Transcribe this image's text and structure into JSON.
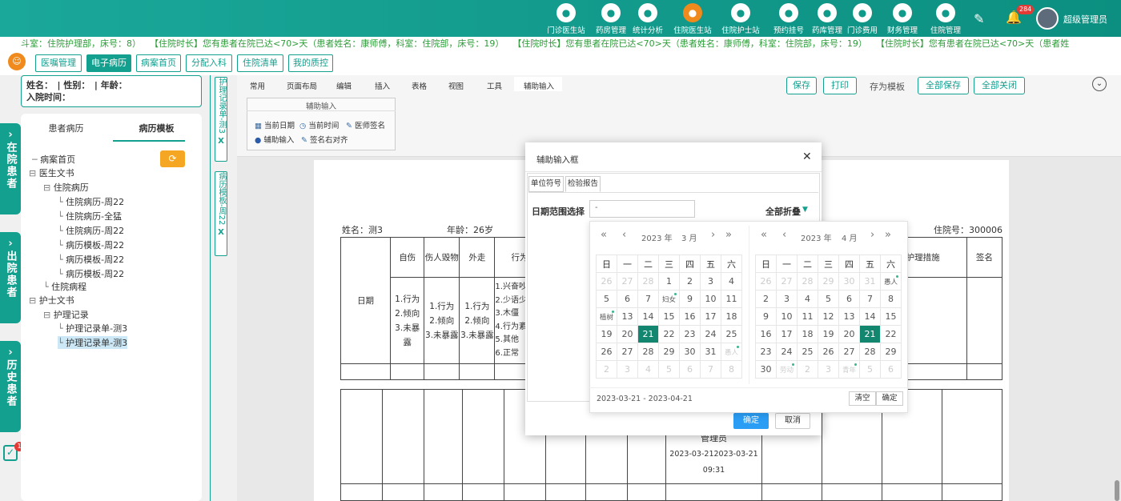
{
  "topnav": {
    "items": [
      {
        "label": "门诊医生站",
        "icon": "doctor-icon"
      },
      {
        "label": "药房管理",
        "icon": "pill-icon"
      },
      {
        "label": "统计分析",
        "icon": "chart-icon"
      },
      {
        "label": "住院医生站",
        "icon": "inpatient-doctor-icon"
      },
      {
        "label": "住院护士站",
        "icon": "nurse-icon"
      },
      {
        "label": "预约挂号",
        "icon": "calendar-icon"
      },
      {
        "label": "药库管理",
        "icon": "warehouse-icon"
      },
      {
        "label": "门诊费用",
        "icon": "yen-icon"
      },
      {
        "label": "财务管理",
        "icon": "gear-icon"
      },
      {
        "label": "住院管理",
        "icon": "bed-icon"
      }
    ],
    "bell_count": "284",
    "user_name": "超级管理员"
  },
  "marquee": "斗室：住院护理部，床号：8）　　【住院时长】您有患者在院已达<70>天（患者姓名：康师傅，科室：住院部，床号：19）　　【住院时长】您有患者在院已达<70>天（患者姓名：康师傅，科室：住院部，床号：19）　　【住院时长】您有患者在院已达<70>天（患者姓",
  "tabs": [
    "医嘱管理",
    "电子病历",
    "病案首页",
    "分配入科",
    "住院清单",
    "我的质控"
  ],
  "sidetabs": [
    "在院患者",
    "出院患者",
    "历史患者"
  ],
  "notif_count": "1",
  "patient": {
    "line1": "姓名：　| 性别：　| 年龄：",
    "line2": "入院时间："
  },
  "tree": {
    "tab1": "患者病历",
    "tab2": "病历模板",
    "nodes": [
      "病案首页",
      "医生文书",
      "住院病历",
      "住院病历-周22",
      "住院病历-全猛",
      "住院病历-周22",
      "病历模板-周22",
      "病历模板-周22",
      "病历模板-周22",
      "住院病程",
      "护士文书",
      "护理记录",
      "护理记录单-测3",
      "护理记录单-测3"
    ]
  },
  "doctabs": [
    {
      "label": "护理记录单-测3",
      "close": "X"
    },
    {
      "label": "病历模板-周22",
      "close": "X"
    }
  ],
  "ribbon": {
    "tabs": [
      "常用",
      "页面布局",
      "编辑",
      "插入",
      "表格",
      "视图",
      "工具",
      "辅助输入"
    ],
    "buttons": [
      "保存",
      "打印",
      "存为模板",
      "全部保存",
      "全部关闭"
    ],
    "group_title": "辅助输入",
    "group_items": [
      "当前日期",
      "当前时间",
      "医师签名",
      "辅助输入",
      "签名右对齐"
    ]
  },
  "page": {
    "name": "姓名：测3",
    "age": "年龄：26岁",
    "hosp_no": "住院号：300006",
    "col_date": "日期",
    "cols": [
      "自伤",
      "伤人毁物",
      "外走",
      "行为"
    ],
    "col_measures": "护理措施",
    "col_sign": "签名",
    "cell_a": "1.行为\n2.倾向\n3.未暴露",
    "cell_b": "1.兴奋吵\n2.少语少\n3.木僵\n4.行为紊\n5.其他\n6.正常",
    "bottom_name": "管理员",
    "bottom_dates": "2023-03-212023-03-21",
    "bottom_time": "09:31"
  },
  "modal": {
    "title": "辅助输入框",
    "tab1": "单位符号",
    "tab2": "检验报告",
    "range_label": "日期范围选择",
    "range_value": "-",
    "fold_all": "全部折叠",
    "ok": "确定",
    "cancel": "取消"
  },
  "calendar": {
    "left_year": "2023 年",
    "left_month": "3 月",
    "right_year": "2023 年",
    "right_month": "4 月",
    "weekdays": [
      "日",
      "一",
      "二",
      "三",
      "四",
      "五",
      "六"
    ],
    "range_text": "2023-03-21 - 2023-04-21",
    "clear": "清空",
    "confirm": "确定"
  }
}
